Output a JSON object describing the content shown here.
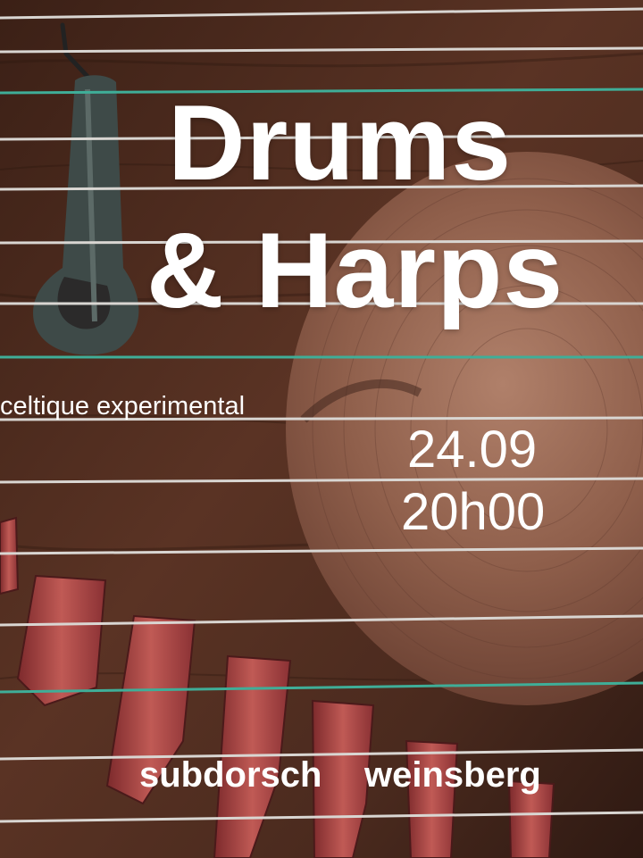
{
  "poster": {
    "title_line1": "Drums",
    "title_line2": "& Harps",
    "subtitle": "celtique experimental",
    "date": "24.09",
    "time": "20h00",
    "venue_left": "subdorsch",
    "venue_right": "weinsberg"
  },
  "colors": {
    "text": "#ffffff",
    "wood_dark": "#3a2118",
    "wood_mid": "#5c3527",
    "cymbal": "#9a6a55",
    "string_silver": "#d9d6d2",
    "string_green": "#3fae98",
    "bridge_red": "#b14a45"
  },
  "icons": [
    "jaw-harp-icon",
    "cymbal-icon",
    "harp-strings-icon",
    "harp-bridges-icon"
  ]
}
